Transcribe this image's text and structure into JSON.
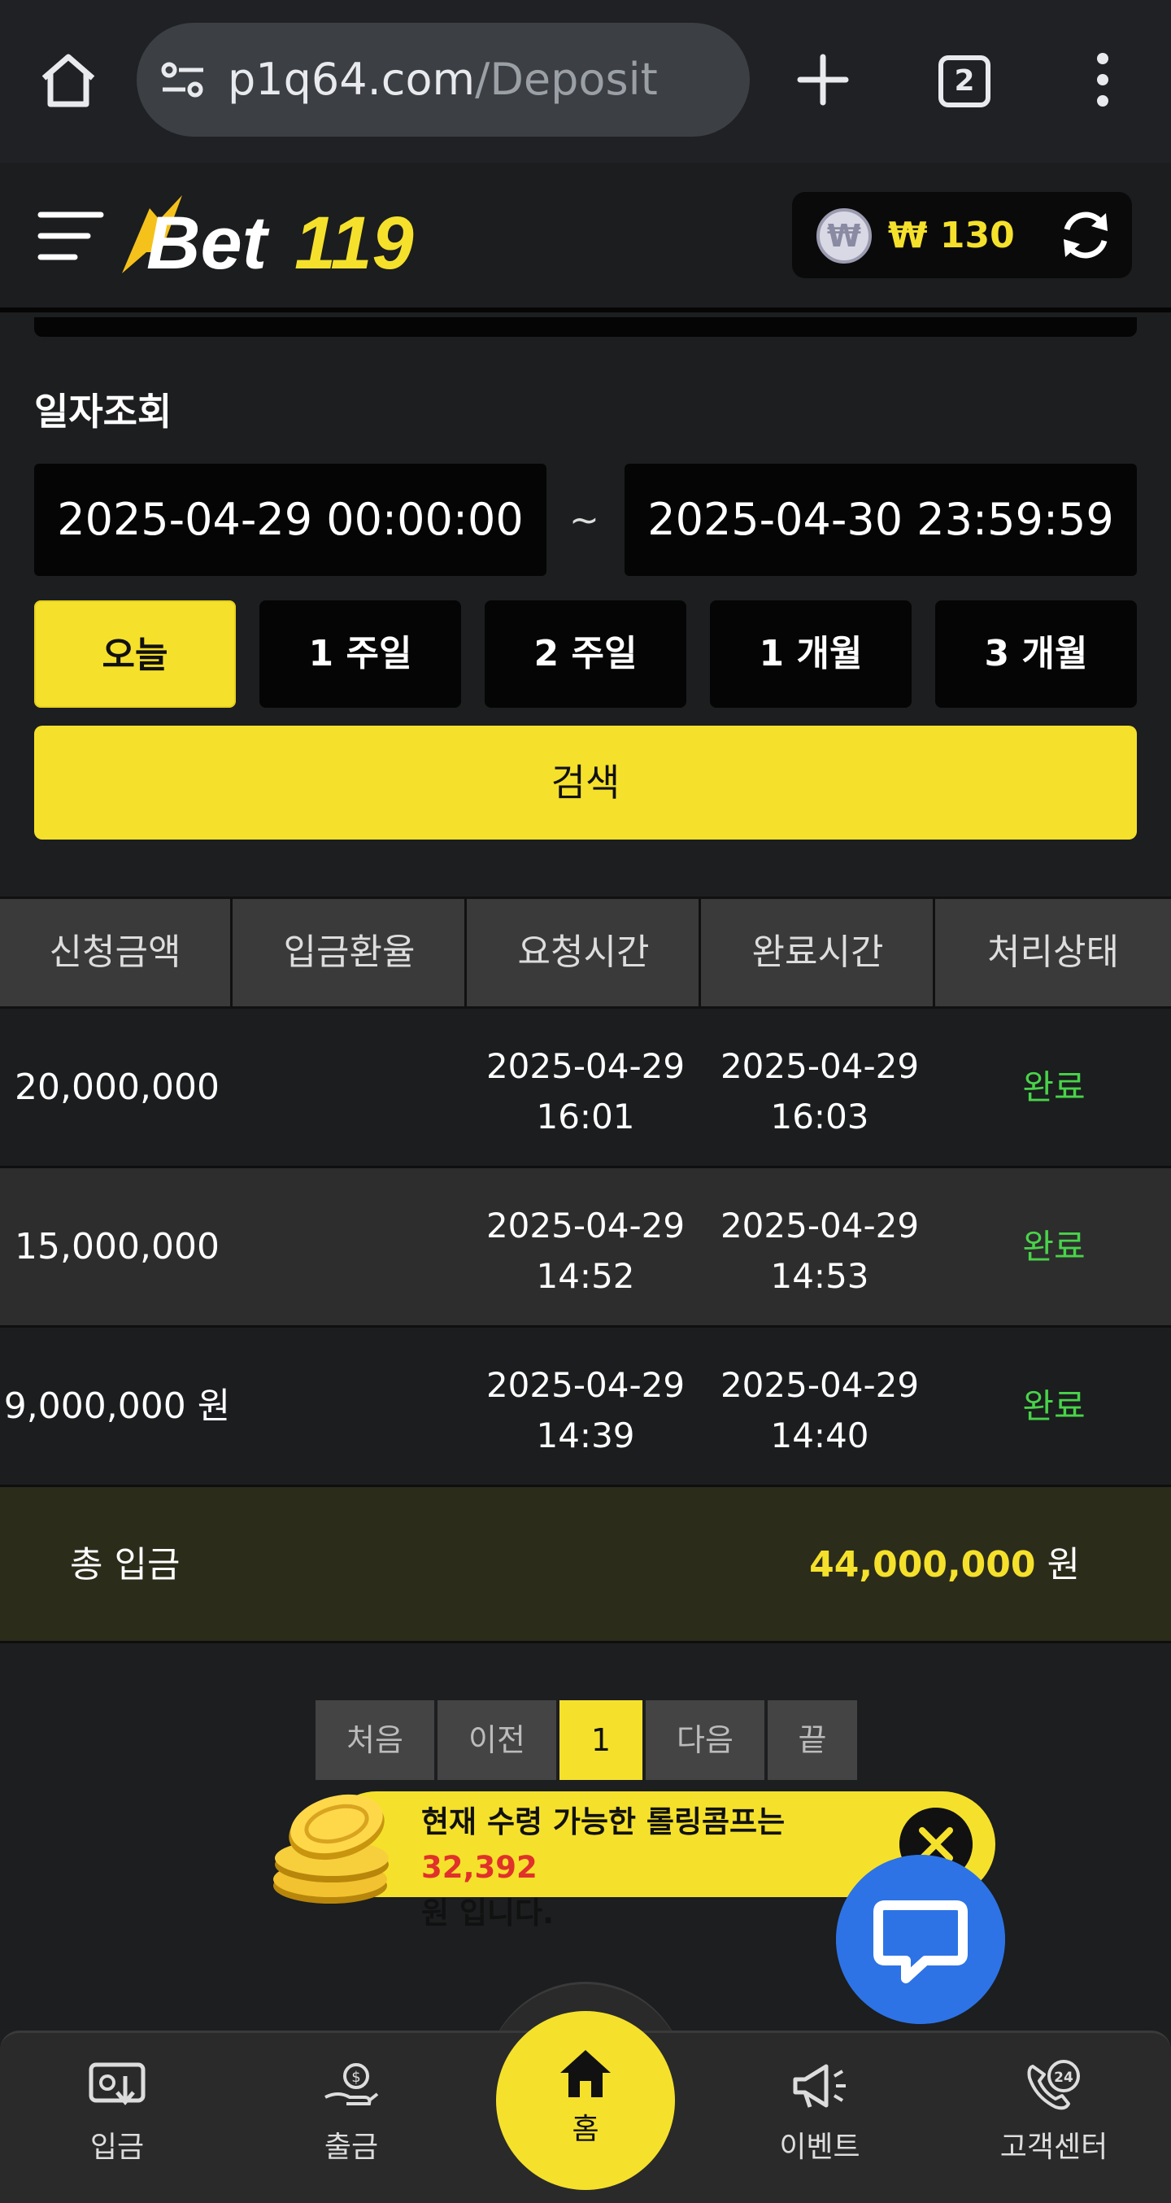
{
  "browser": {
    "url_host": "p1q64.com",
    "url_path": "/Deposit",
    "tab_count": "2"
  },
  "header": {
    "logo_text": "Bet119",
    "currency_symbol": "₩",
    "balance": "₩ 130"
  },
  "filter": {
    "label": "일자조회",
    "date_from": "2025-04-29 00:00:00",
    "separator": "~",
    "date_to": "2025-04-30 23:59:59",
    "ranges": [
      "오늘",
      "1 주일",
      "2 주일",
      "1 개월",
      "3 개월"
    ],
    "active_range": "오늘",
    "search_label": "검색"
  },
  "table": {
    "columns": [
      "신청금액",
      "입금환율",
      "요청시간",
      "완료시간",
      "처리상태"
    ],
    "rows": [
      {
        "amount": "20,000,000 원",
        "rate": "",
        "req_date": "2025-04-29",
        "req_time": "16:01",
        "done_date": "2025-04-29",
        "done_time": "16:03",
        "status": "완료"
      },
      {
        "amount": "15,000,000 원",
        "rate": "",
        "req_date": "2025-04-29",
        "req_time": "14:52",
        "done_date": "2025-04-29",
        "done_time": "14:53",
        "status": "완료"
      },
      {
        "amount": "9,000,000 원",
        "rate": "",
        "req_date": "2025-04-29",
        "req_time": "14:39",
        "done_date": "2025-04-29",
        "done_time": "14:40",
        "status": "완료"
      }
    ],
    "total_label": "총 입금",
    "total_value": "44,000,000",
    "total_unit": "원"
  },
  "pagination": {
    "first": "처음",
    "prev": "이전",
    "current": "1",
    "next": "다음",
    "last": "끝"
  },
  "comp_banner": {
    "text_before": "현재 수령 가능한 롤링콤프는",
    "amount": "32,392",
    "text_after": "원 입니다."
  },
  "bottom_nav": {
    "deposit": "입금",
    "withdraw": "출금",
    "home": "홈",
    "events": "이벤트",
    "support": "고객센터"
  },
  "colors": {
    "accent": "#f5e12b",
    "status_done": "#49d34a",
    "comp_amount": "#e0312b",
    "chat": "#2d73e6"
  },
  "icons": [
    "home-icon",
    "tune-icon",
    "plus-icon",
    "tabs-icon",
    "more-vert-icon",
    "menu-icon",
    "won-icon",
    "refresh-icon",
    "coins-icon",
    "close-icon",
    "chat-icon",
    "deposit-icon",
    "withdraw-icon",
    "events-icon",
    "support-icon"
  ]
}
